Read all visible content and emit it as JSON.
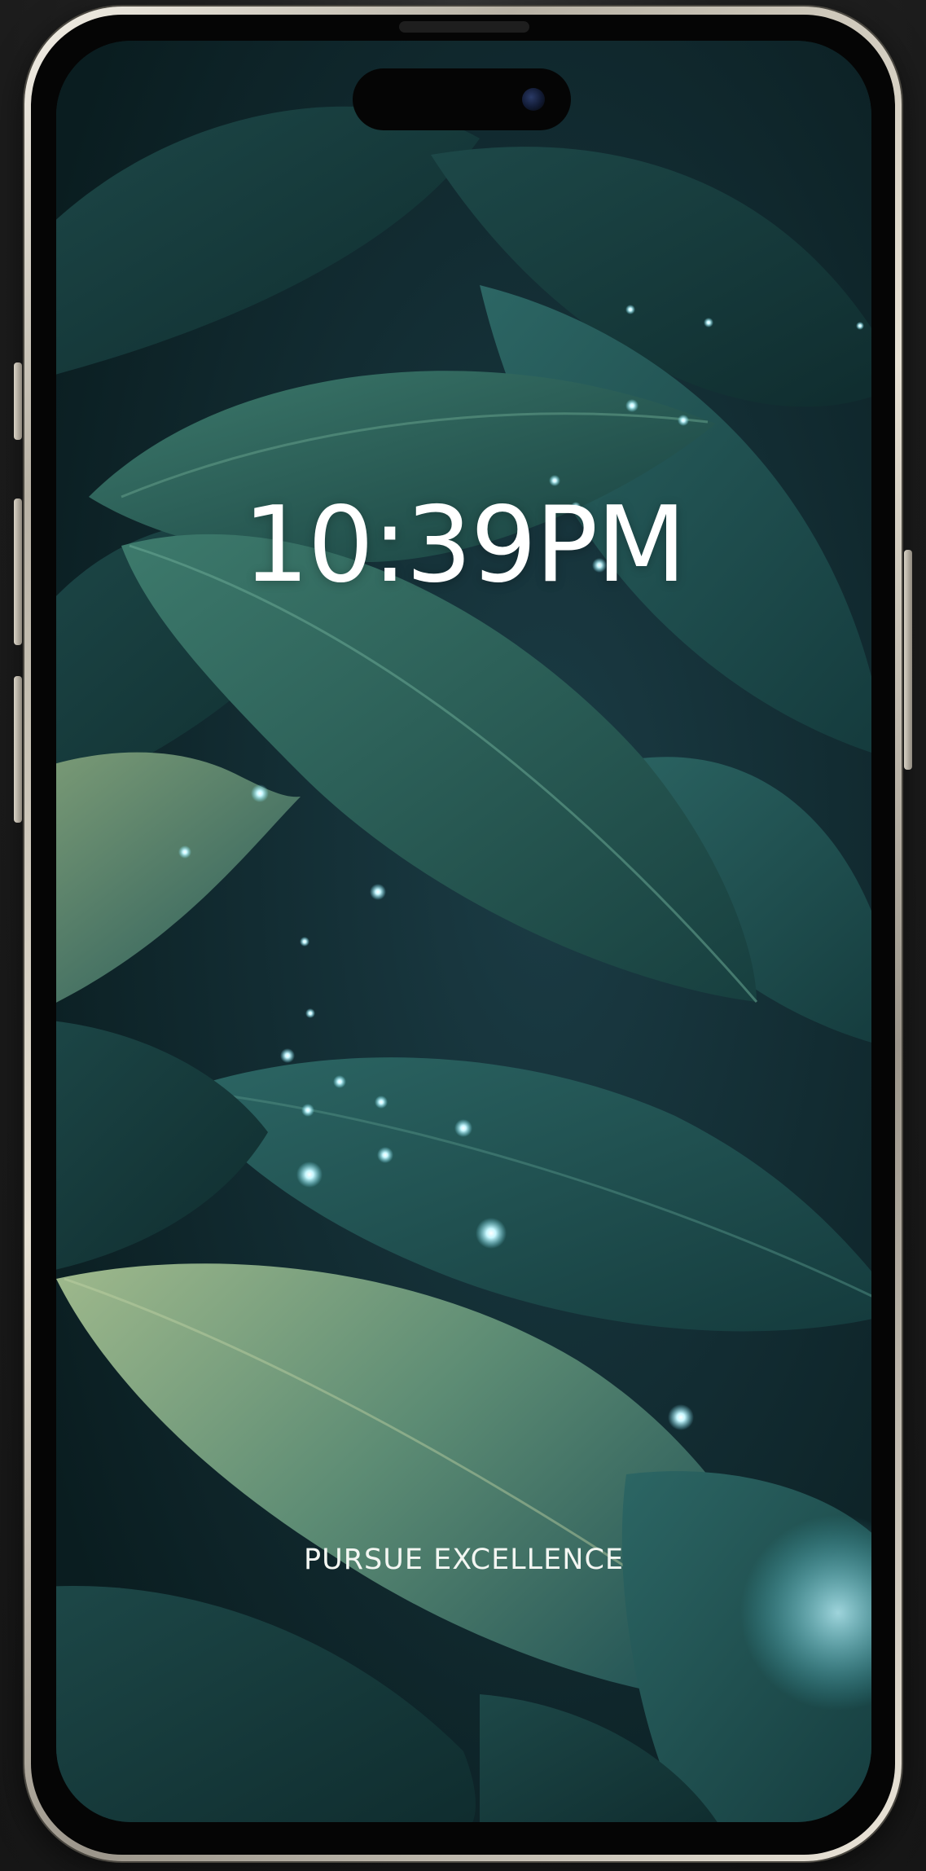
{
  "lock_screen": {
    "time": "10:39PM",
    "motto": "PURSUE EXCELLENCE"
  },
  "wallpaper": {
    "theme": "dark-teal-leaves-with-fireflies",
    "colors": {
      "deep": "#0c2426",
      "leaf_dark": "#1f4a4a",
      "leaf_mid": "#2f6660",
      "leaf_light": "#8fae83",
      "glow": "#bff6ff"
    }
  },
  "device": {
    "frame_color": "#d9d3c6",
    "bezel_color": "#050505"
  }
}
